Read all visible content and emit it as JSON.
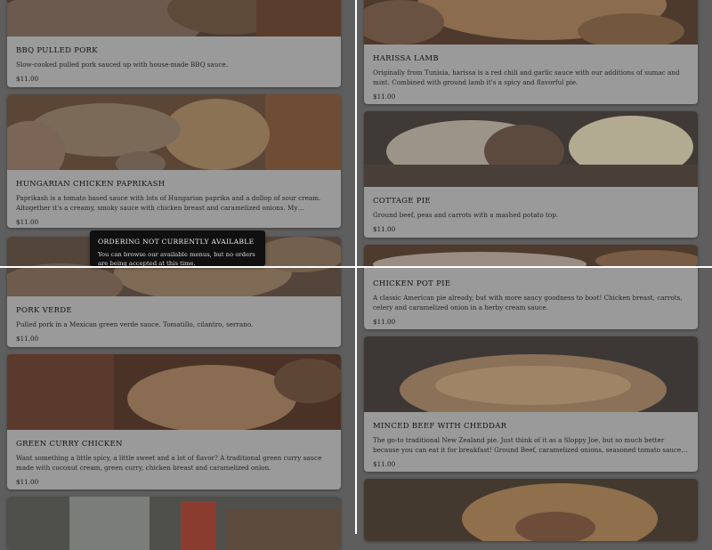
{
  "menu_items_left": [
    {
      "title": "BBQ PULLED PORK",
      "description": "Slow-cooked pulled pork sauced up with house-made BBQ sauce.",
      "price": "$11.00"
    },
    {
      "title": "HUNGARIAN CHICKEN PAPRIKASH",
      "description": "Paprikash is a tomato based sauce with lots of Hungarian paprika and a dollop of sour cream. Altogether it's a creamy, smoky sauce with chicken breast and caramelized onions. My Hungarian friend said it's al...",
      "price": "$11.00"
    },
    {
      "title": "PORK VERDE",
      "description": "Pulled pork in a Mexican green verde sauce. Tomatillo, cilantro, serrano.",
      "price": "$11.00"
    },
    {
      "title": "GREEN CURRY CHICKEN",
      "description": "Want something a little spicy, a little sweet and a lot of flavor? A traditional green curry sauce made with coconut cream, green curry, chicken breast and caramelized onion.",
      "price": "$11.00"
    }
  ],
  "menu_items_right": [
    {
      "title": "HARISSA LAMB",
      "description": "Originally from Tunisia, harissa is a red chili and garlic sauce with our additions of sumac and mint. Combined with ground lamb it's a spicy and flavorful pie.",
      "price": "$11.00"
    },
    {
      "title": "COTTAGE PIE",
      "description": "Ground beef, peas and carrots with a mashed potato top.",
      "price": "$11.00"
    },
    {
      "title": "CHICKEN POT PIE",
      "description": "A classic American pie already, but with more saucy goodness to boot! Chicken breast, carrots, celery and caramelized onion in a herby cream sauce.",
      "price": "$11.00"
    },
    {
      "title": "MINCED BEEF WITH CHEDDAR",
      "description": "The go-to traditional New Zealand pie. Just think of it as a Sloppy Joe, but so much better because you can eat it for breakfast! Ground Beef, caramelized onions, seasoned tomato sauce with Cheddar cheese.",
      "price": "$11.00"
    }
  ],
  "tooltip": {
    "title": "ORDERING NOT CURRENTLY AVAILABLE",
    "body": "You can browse our available menus, but no orders are being accepted at this time."
  },
  "colors": {
    "overlay": "#5e5e5e",
    "card": "#9a9a9a",
    "tooltip_bg": "#101010",
    "divider": "#ffffff"
  }
}
